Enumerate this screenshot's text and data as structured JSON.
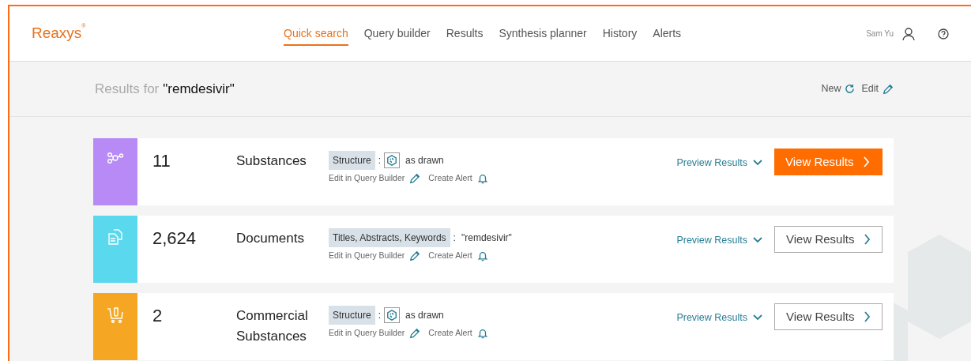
{
  "brand": {
    "logo": "Reaxys",
    "mark": "®"
  },
  "nav": [
    {
      "label": "Quick search",
      "selected": true
    },
    {
      "label": "Query builder",
      "selected": false
    },
    {
      "label": "Results",
      "selected": false
    },
    {
      "label": "Synthesis planner",
      "selected": false
    },
    {
      "label": "History",
      "selected": false
    },
    {
      "label": "Alerts",
      "selected": false
    }
  ],
  "user": {
    "name": "Sam Yu"
  },
  "results_header": {
    "prefix": "Results for",
    "query": "\"remdesivir\"",
    "new_label": "New",
    "edit_label": "Edit"
  },
  "results": [
    {
      "kind": "substances",
      "color": "#b78af6",
      "count": "11",
      "label": "Substances",
      "query": {
        "kind": "structure",
        "field": "Structure",
        "separator": ":",
        "value": "as drawn"
      },
      "edit_link": "Edit in Query Builder",
      "alert_link": "Create Alert",
      "preview": "Preview Results",
      "button": {
        "label": "View Results",
        "primary": true
      }
    },
    {
      "kind": "documents",
      "color": "#5ad9ee",
      "count": "2,624",
      "label": "Documents",
      "query": {
        "kind": "text",
        "field": "Titles, Abstracts, Keywords",
        "separator": ":",
        "value": "\"remdesivir\""
      },
      "edit_link": "Edit in Query Builder",
      "alert_link": "Create Alert",
      "preview": "Preview Results",
      "button": {
        "label": "View Results",
        "primary": false
      }
    },
    {
      "kind": "commercial",
      "color": "#f5a623",
      "count": "2",
      "label": "Commercial Substances",
      "query": {
        "kind": "structure",
        "field": "Structure",
        "separator": ":",
        "value": "as drawn"
      },
      "edit_link": "Edit in Query Builder",
      "alert_link": "Create Alert",
      "preview": "Preview Results",
      "button": {
        "label": "View Results",
        "primary": false
      }
    }
  ]
}
